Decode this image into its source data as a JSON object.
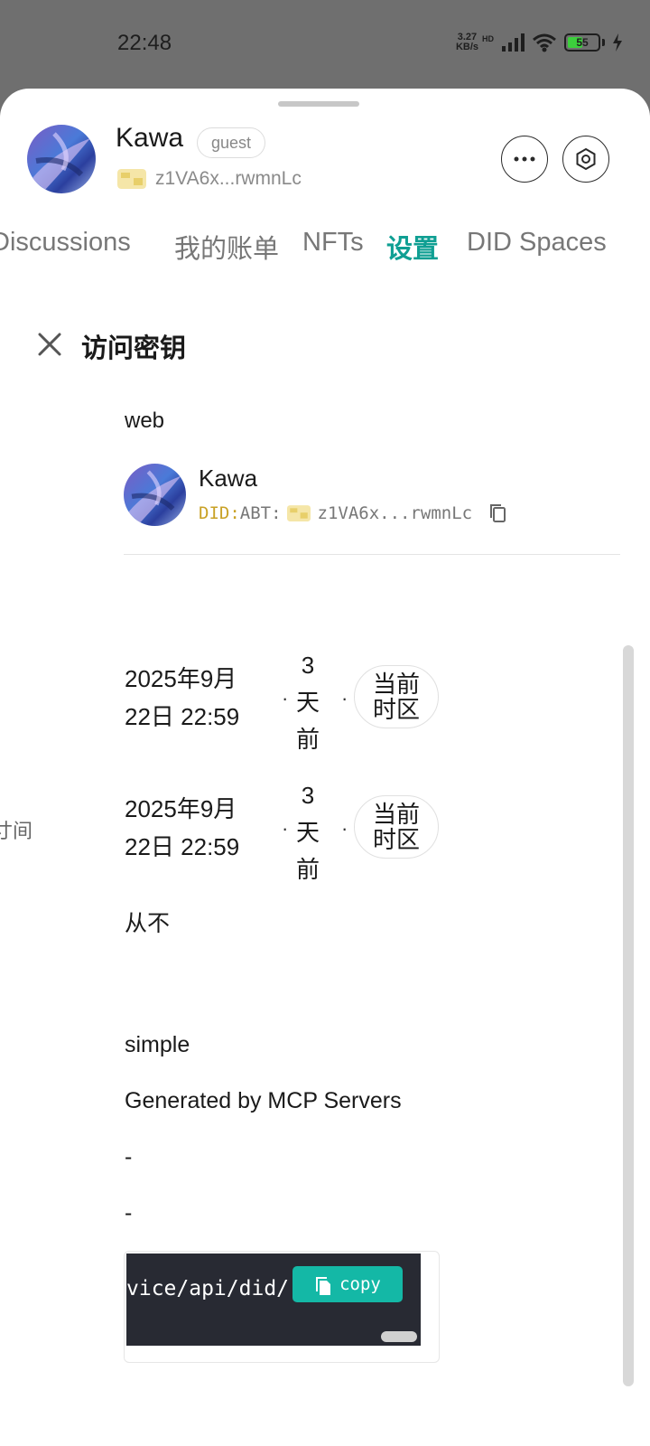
{
  "status_bar": {
    "time": "22:48",
    "net_speed_value": "3.27",
    "net_speed_unit": "KB/s",
    "network_badge": "HD",
    "battery": "55",
    "battery_level_percent": 55
  },
  "profile": {
    "name": "Kawa",
    "role_badge": "guest",
    "did_short": "z1VA6x...rwmnLc"
  },
  "tabs": [
    {
      "label": "Discussions",
      "active": false
    },
    {
      "label": "我的账单",
      "active": false
    },
    {
      "label": "NFTs",
      "active": false
    },
    {
      "label": "设置",
      "active": true
    },
    {
      "label": "DID Spaces",
      "active": false
    }
  ],
  "panel": {
    "title": "访问密钥",
    "source": "web",
    "owner": {
      "name": "Kawa",
      "did_prefix": "DID:",
      "did_type": "ABT:",
      "did_address": "z1VA6x...rwmnLc"
    },
    "created": {
      "date_line1": "2025年9月",
      "date_line2": "22日 22:59",
      "relative": [
        "3",
        "天",
        "前"
      ],
      "timezone_line1": "当前",
      "timezone_line2": "时区"
    },
    "updated": {
      "date_line1": "2025年9月",
      "date_line2": "22日 22:59",
      "relative": [
        "3",
        "天",
        "前"
      ],
      "timezone_line1": "当前",
      "timezone_line2": "时区"
    },
    "side_label_fragment": "寸间",
    "expires": "从不",
    "auth_type": "simple",
    "remark": "Generated by MCP Servers",
    "field_a": "-",
    "field_b": "-",
    "code_snippet": "vice/api/did/",
    "copy_label": "copy"
  },
  "colors": {
    "accent": "#0f9f93",
    "copy_button": "#14b8a6",
    "code_bg": "#282a33",
    "did_prefix": "#c9a227"
  }
}
